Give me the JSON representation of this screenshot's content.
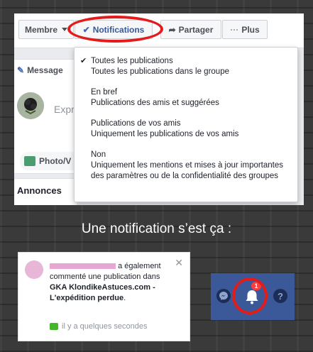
{
  "toolbar": {
    "membre": "Membre",
    "notifications": "Notifications",
    "partager": "Partager",
    "plus": "Plus"
  },
  "compose": {
    "tab_label": "Message",
    "placeholder": "Expr",
    "photo_label": "Photo/V"
  },
  "annonces": "Annonces",
  "dropdown": {
    "items": [
      {
        "title": "Toutes les publications",
        "desc": "Toutes les publications dans le groupe",
        "checked": true
      },
      {
        "title": "En bref",
        "desc": "Publications des amis et suggérées",
        "checked": false
      },
      {
        "title": "Publications de vos amis",
        "desc": "Uniquement les publications de vos amis",
        "checked": false
      },
      {
        "title": "Non",
        "desc": "Uniquement les mentions et mises à jour importantes des paramètres ou de la confidentialité des groupes",
        "checked": false
      }
    ]
  },
  "caption": "Une notification s’est ça :",
  "notification": {
    "text_part1": "a également commenté une publication dans",
    "group_name": "GKA KlondikeAstuces.com - L'expédition perdue",
    "period": ".",
    "time": "il y a quelques secondes",
    "close": "✕"
  },
  "nav": {
    "badge": "1",
    "help": "?"
  },
  "colors": {
    "facebook_blue": "#3b5998",
    "highlight_red": "#e31b1b",
    "badge_red": "#fa3e3e"
  }
}
